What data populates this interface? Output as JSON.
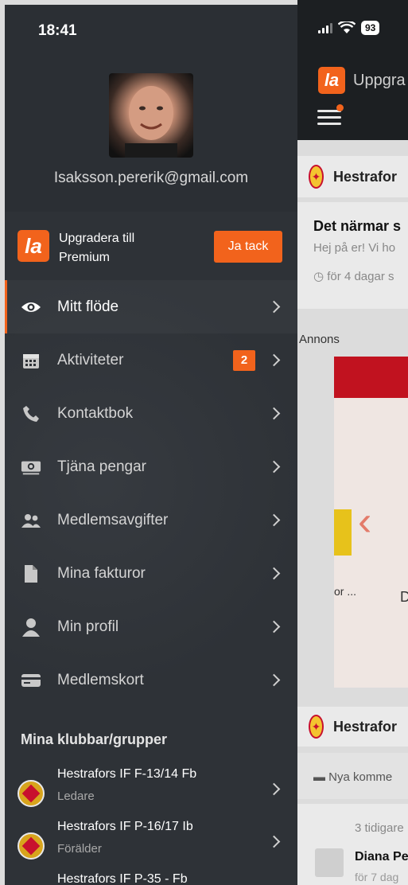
{
  "status_bar": {
    "time": "18:41",
    "battery": "93"
  },
  "background_app": {
    "app_title": "Uppgra",
    "club_header_1": "Hestrafor",
    "post_title": "Det närmar s",
    "post_preview": "Hej på er! Vi ho",
    "post_time": "för 4 dagar s",
    "ad_label": "Annons",
    "ad_text_left": "or ...",
    "ad_text_right": "D",
    "club_header_2": "Hestrafor",
    "comments_label": "Nya komme",
    "previous_comments": "3 tidigare",
    "commenter_name": "Diana Pe",
    "commenter_time": "för 7 dag"
  },
  "drawer": {
    "email": "Isaksson.pererik@gmail.com",
    "upgrade": {
      "line1": "Upgradera till",
      "line2": "Premium",
      "button": "Ja tack"
    },
    "menu": [
      {
        "label": "Mitt flöde",
        "icon": "eye-icon",
        "active": true
      },
      {
        "label": "Aktiviteter",
        "icon": "calendar-icon",
        "badge": "2"
      },
      {
        "label": "Kontaktbok",
        "icon": "phone-icon"
      },
      {
        "label": "Tjäna pengar",
        "icon": "money-icon"
      },
      {
        "label": "Medlemsavgifter",
        "icon": "group-icon"
      },
      {
        "label": "Mina fakturor",
        "icon": "document-icon"
      },
      {
        "label": "Min profil",
        "icon": "person-icon"
      },
      {
        "label": "Medlemskort",
        "icon": "card-icon"
      }
    ],
    "clubs_title": "Mina klubbar/grupper",
    "clubs": [
      {
        "name": "Hestrafors IF F-13/14 Fb",
        "role": "Ledare"
      },
      {
        "name": "Hestrafors IF P-16/17 Ib",
        "role": "Förälder"
      },
      {
        "name": "Hestrafors IF P-35 - Fb",
        "role": ""
      }
    ]
  },
  "colors": {
    "accent": "#f2631c",
    "drawer_bg": "#2e3237"
  }
}
